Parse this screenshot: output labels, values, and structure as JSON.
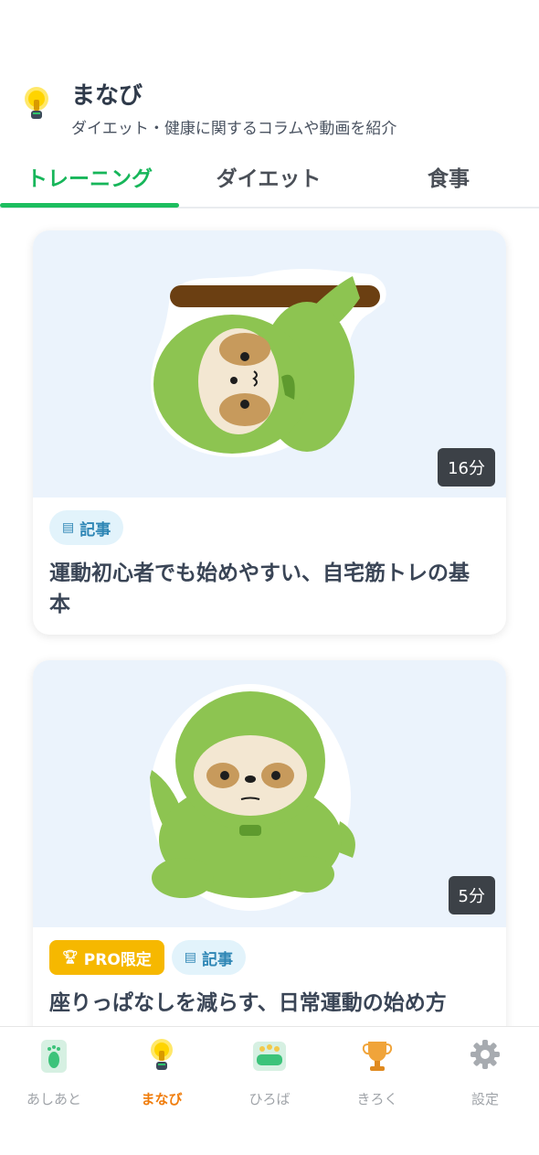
{
  "header": {
    "title": "まなび",
    "subtitle": "ダイエット・健康に関するコラムや動画を紹介",
    "icon": "lightbulb-icon"
  },
  "tabs": [
    {
      "label": "トレーニング",
      "active": true
    },
    {
      "label": "ダイエット",
      "active": false
    },
    {
      "label": "食事",
      "active": false
    }
  ],
  "cards": [
    {
      "duration": "16分",
      "badges": [
        {
          "label": "記事",
          "type": "kiji"
        }
      ],
      "title": "運動初心者でも始めやすい、自宅筋トレの基本"
    },
    {
      "duration": "5分",
      "badges": [
        {
          "label": "PRO限定",
          "type": "pro"
        },
        {
          "label": "記事",
          "type": "kiji"
        }
      ],
      "title": "座りっぱなしを減らす、日常運動の始め方"
    }
  ],
  "bottom_nav": [
    {
      "label": "あしあと",
      "icon": "footprint-icon",
      "active": false
    },
    {
      "label": "まなび",
      "icon": "lightbulb-icon",
      "active": true
    },
    {
      "label": "ひろば",
      "icon": "plaza-icon",
      "active": false
    },
    {
      "label": "きろく",
      "icon": "trophy-icon",
      "active": false
    },
    {
      "label": "設定",
      "icon": "gear-icon",
      "active": false
    }
  ],
  "colors": {
    "accent_green": "#1dbe5f",
    "active_nav_orange": "#f07c0a",
    "pro_badge": "#f6b800",
    "kiji_badge_bg": "#e2f3fb",
    "thumb_bg": "#ebf3fc"
  }
}
